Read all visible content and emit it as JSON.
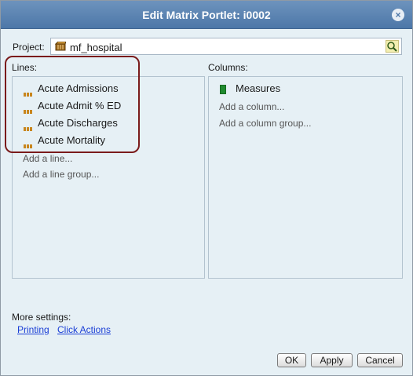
{
  "dialog": {
    "title": "Edit Matrix Portlet: i0002",
    "close_glyph": "×"
  },
  "project": {
    "label": "Project:",
    "value": "mf_hospital"
  },
  "lines": {
    "label": "Lines:",
    "items": [
      "Acute Admissions",
      "Acute Admit % ED",
      "Acute Discharges",
      "Acute Mortality"
    ],
    "add_line": "Add a line...",
    "add_line_group": "Add a line group..."
  },
  "columns": {
    "label": "Columns:",
    "items": [
      "Measures"
    ],
    "add_column": "Add a column...",
    "add_column_group": "Add a column group..."
  },
  "more_settings": {
    "label": "More settings:",
    "links": [
      "Printing",
      "Click Actions"
    ]
  },
  "buttons": {
    "ok": "OK",
    "apply": "Apply",
    "cancel": "Cancel"
  },
  "colors": {
    "titlebar": "#5a83b3",
    "dialog_background": "#e6f0f5",
    "highlight_border": "#7a1b1b",
    "link": "#1a3ed6"
  }
}
